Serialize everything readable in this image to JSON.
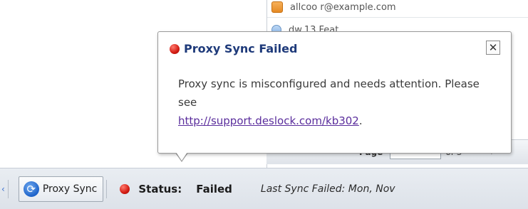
{
  "list": {
    "rows": [
      {
        "text": "allcoo r@example.com"
      },
      {
        "text": "dw.13.Feat..."
      }
    ]
  },
  "pager": {
    "page_label": "Page",
    "page_value": "",
    "total": "of 3"
  },
  "balloon": {
    "title": "Proxy Sync Failed",
    "close_symbol": "✕",
    "message": "Proxy sync is misconfigured and needs attention. Please see",
    "link": "http://support.deslock.com/kb302",
    "link_suffix": "."
  },
  "statusbar": {
    "proxy_sync_label": "Proxy Sync",
    "status_label": "Status:",
    "status_value": "Failed",
    "last_sync": "Last Sync Failed: Mon, Nov"
  },
  "colors": {
    "title": "#1e3a7a",
    "error_red": "#d21b12",
    "link": "#5a2d9c"
  },
  "icons": {
    "balloon_error": "red-dot-icon",
    "proxy_sync": "sync-icon",
    "status_error": "red-dot-icon"
  }
}
